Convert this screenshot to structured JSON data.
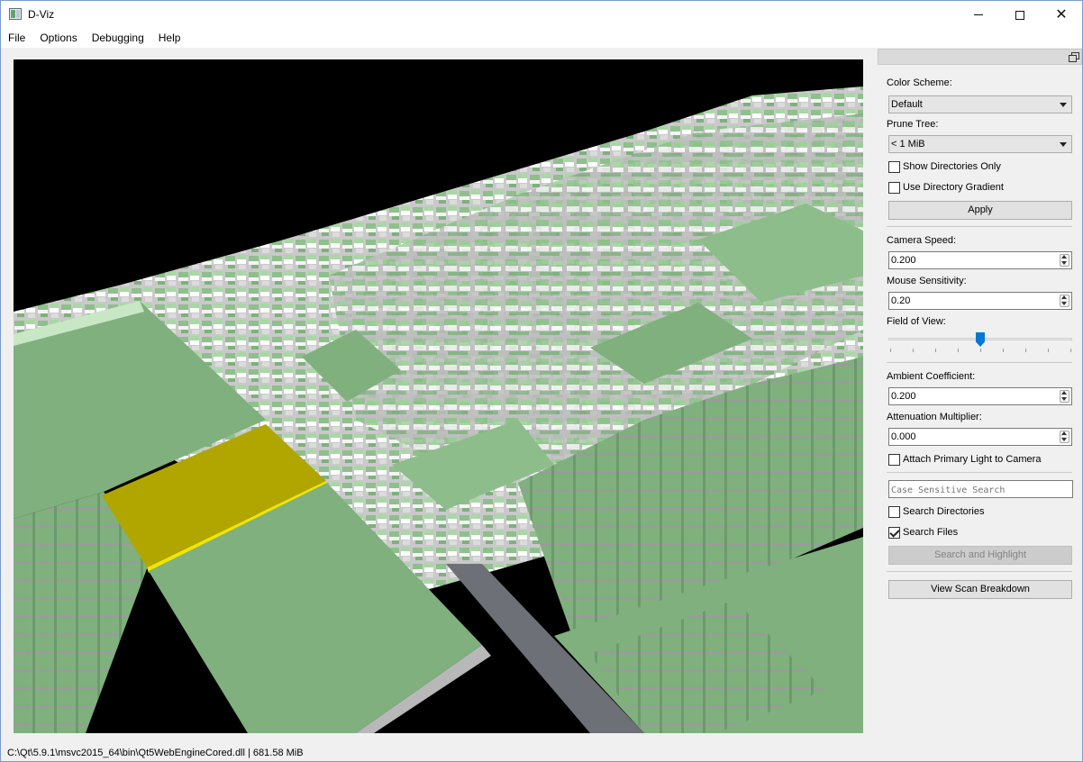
{
  "window": {
    "title": "D-Viz",
    "icon": "app-icon"
  },
  "menu": [
    {
      "label": "File"
    },
    {
      "label": "Options"
    },
    {
      "label": "Debugging"
    },
    {
      "label": "Help"
    }
  ],
  "panel": {
    "color_scheme": {
      "label": "Color Scheme:",
      "value": "Default"
    },
    "prune_tree": {
      "label": "Prune Tree:",
      "value": "< 1 MiB"
    },
    "show_dirs_only": {
      "label": "Show Directories Only",
      "checked": false
    },
    "use_dir_gradient": {
      "label": "Use Directory Gradient",
      "checked": false
    },
    "apply_label": "Apply",
    "camera_speed": {
      "label": "Camera Speed:",
      "value": "0.200"
    },
    "mouse_sensitivity": {
      "label": "Mouse Sensitivity:",
      "value": "0.20"
    },
    "field_of_view": {
      "label": "Field of View:",
      "level": 0.5
    },
    "ambient": {
      "label": "Ambient Coefficient:",
      "value": "0.200"
    },
    "attenuation": {
      "label": "Attenuation Multiplier:",
      "value": "0.000"
    },
    "attach_light": {
      "label": "Attach Primary Light to Camera",
      "checked": false
    },
    "search": {
      "placeholder": "Case Sensitive Search"
    },
    "search_dirs": {
      "label": "Search Directories",
      "checked": false
    },
    "search_files": {
      "label": "Search Files",
      "checked": true
    },
    "search_button": "Search and Highlight",
    "breakdown_button": "View Scan Breakdown"
  },
  "status": "C:\\Qt\\5.9.1\\msvc2015_64\\bin\\Qt5WebEngineCored.dll  |  681.58 MiB",
  "colors": {
    "tile_green": "#7fb07e",
    "tile_light": "#c8e8c5",
    "highlight": "#b4a800",
    "background": "#000000"
  }
}
